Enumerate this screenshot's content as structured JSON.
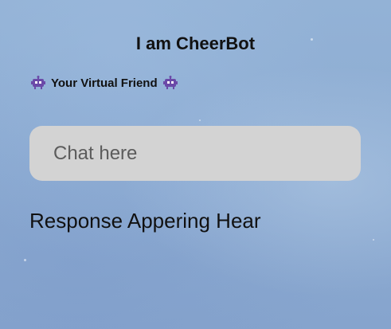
{
  "header": {
    "title": "I am CheerBot",
    "subtitle": "Your Virtual Friend",
    "subtitle_icon": "robot-icon"
  },
  "chat": {
    "placeholder": "Chat here",
    "value": ""
  },
  "response": {
    "text": "Response Appering Hear"
  },
  "colors": {
    "background": "#8eadd3",
    "input_background": "#d3d3d3",
    "text": "#111111",
    "icon": "#6b4aa8"
  }
}
